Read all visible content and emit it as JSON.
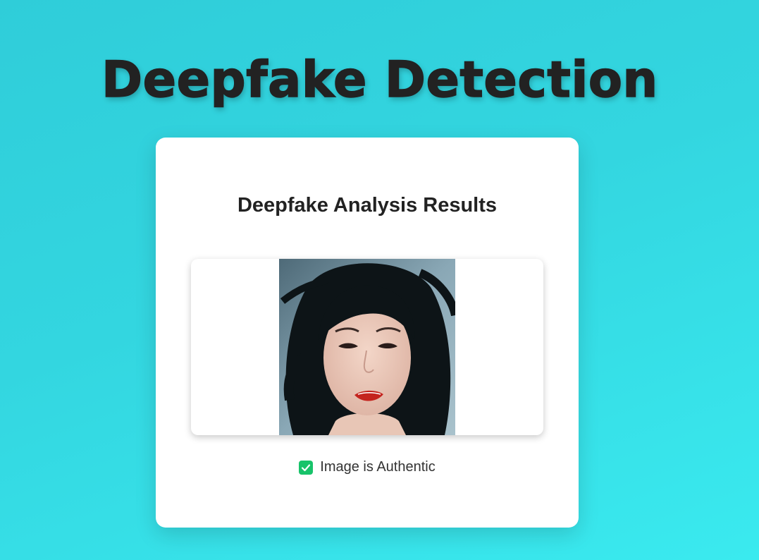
{
  "page": {
    "title": "Deepfake Detection"
  },
  "card": {
    "title": "Deepfake Analysis Results",
    "image": {
      "description_icon": "portrait-photo"
    },
    "result": {
      "icon": "check-icon",
      "icon_color": "#18c36a",
      "text": "Image is Authentic"
    }
  },
  "colors": {
    "background_start": "#2fcdd9",
    "background_end": "#3aeaef",
    "title_text": "#222222"
  }
}
